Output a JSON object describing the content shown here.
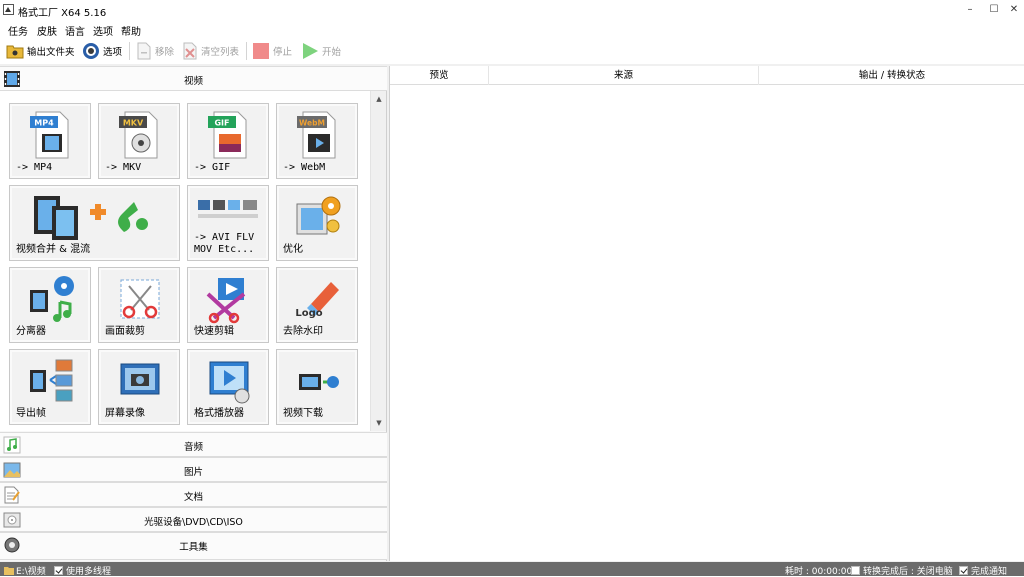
{
  "window": {
    "title": "格式工厂 X64 5.16",
    "minimize": "–",
    "maximize": "☐",
    "close": "✕"
  },
  "menu": [
    "任务",
    "皮肤",
    "语言",
    "选项",
    "帮助"
  ],
  "toolbar": {
    "output_folder": "输出文件夹",
    "options": "选项",
    "remove": "移除",
    "clear_list": "清空列表",
    "stop": "停止",
    "start": "开始"
  },
  "categories": {
    "video": "视频",
    "audio": "音频",
    "image": "图片",
    "document": "文档",
    "disc": "光驱设备\\DVD\\CD\\ISO",
    "tools": "工具集"
  },
  "tiles": [
    {
      "label": "-> MP4",
      "badge": "MP4",
      "badge_color": "#2f7fd1",
      "icon": "mp4-file-icon"
    },
    {
      "label": "-> MKV",
      "badge": "MKV",
      "badge_color": "#4a4a4a",
      "icon": "mkv-file-icon"
    },
    {
      "label": "-> GIF",
      "badge": "GIF",
      "badge_color": "#23a35a",
      "icon": "gif-file-icon"
    },
    {
      "label": "-> WebM",
      "badge": "WebM",
      "badge_color": "#6b6b6b",
      "icon": "webm-file-icon"
    },
    {
      "label": "视频合并 & 混流",
      "icon": "video-merge-icon"
    },
    {
      "label": "-> AVI FLV\nMOV Etc...",
      "icon": "multi-format-icon"
    },
    {
      "label": "优化",
      "icon": "optimize-icon"
    },
    {
      "label": "分离器",
      "icon": "splitter-icon"
    },
    {
      "label": "画面裁剪",
      "icon": "crop-icon"
    },
    {
      "label": "快速剪辑",
      "icon": "quick-cut-icon"
    },
    {
      "label": "去除水印",
      "icon": "remove-watermark-icon",
      "logo_text": "Logo"
    },
    {
      "label": "导出帧",
      "icon": "export-frames-icon"
    },
    {
      "label": "屏幕录像",
      "icon": "screen-record-icon"
    },
    {
      "label": "格式播放器",
      "icon": "player-icon"
    },
    {
      "label": "视频下载",
      "icon": "video-download-icon"
    }
  ],
  "table": {
    "columns": [
      "预览",
      "来源",
      "输出 / 转换状态"
    ]
  },
  "status": {
    "output_path": "E:\\视频",
    "multithread_label": "使用多线程",
    "multithread_checked": true,
    "elapsed": "耗时 : 00:00:00",
    "after_convert_label": "转换完成后 : 关闭电脑",
    "after_convert_checked": false,
    "notify_label": "完成通知",
    "notify_checked": true
  },
  "colors": {
    "accent_blue": "#2f7fd1",
    "status_bar": "#6b6b6b",
    "start_green": "#7ed37e",
    "stop_red": "#f08a8a"
  }
}
